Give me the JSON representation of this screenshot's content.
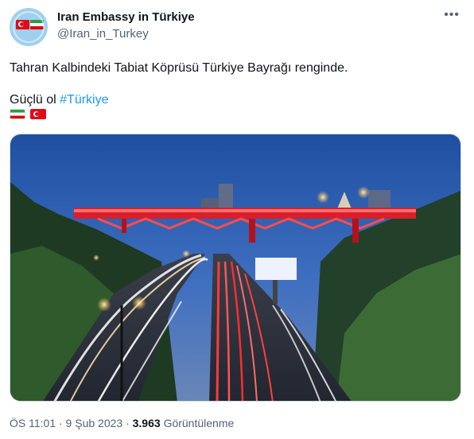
{
  "author": {
    "name": "Iran Embassy in Türkiye",
    "handle": "@Iran_in_Turkey"
  },
  "icons": {
    "more": "more-horizontal-icon",
    "flag_iran": "iran-flag-icon",
    "flag_turkey": "turkey-flag-icon"
  },
  "tweet": {
    "line1": "Tahran Kalbindeki Tabiat Köprüsü Türkiye Bayrağı renginde.",
    "line2_prefix": "Güçlü ol ",
    "hashtag": "#Türkiye"
  },
  "meta": {
    "datetime": "ÖS 11:01 · 9 Şub 2023 · ",
    "views_count": "3.963",
    "views_label": "Görüntülenme"
  },
  "colors": {
    "link": "#1d9bf0",
    "muted": "#536471",
    "text": "#0f1419"
  }
}
